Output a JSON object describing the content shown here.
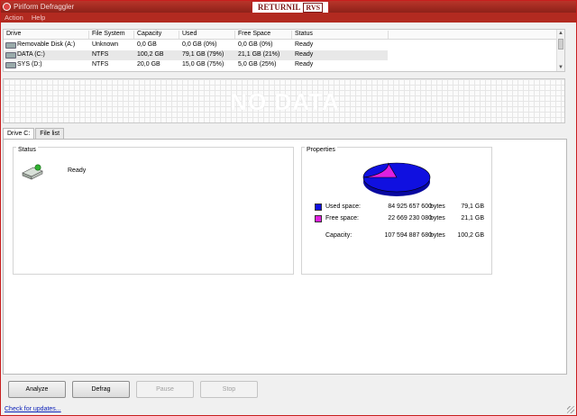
{
  "window": {
    "title": "Piriform Defraggler"
  },
  "returnil": {
    "text": "RETURNIL",
    "badge": "RVS"
  },
  "menu": [
    {
      "label": "Action"
    },
    {
      "label": "Help"
    }
  ],
  "drive_list": {
    "columns": [
      "Drive",
      "File System",
      "Capacity",
      "Used",
      "Free Space",
      "Status"
    ],
    "rows": [
      {
        "drive": "Removable Disk (A:)",
        "fs": "Unknown",
        "capacity": "0,0 GB",
        "used": "0,0 GB (0%)",
        "free": "0,0 GB (0%)",
        "status": "Ready"
      },
      {
        "drive": "DATA (C:)",
        "fs": "NTFS",
        "capacity": "100,2 GB",
        "used": "79,1 GB (79%)",
        "free": "21,1 GB (21%)",
        "status": "Ready",
        "selected": true
      },
      {
        "drive": "SYS (D:)",
        "fs": "NTFS",
        "capacity": "20,0 GB",
        "used": "15,0 GB (75%)",
        "free": "5,0 GB (25%)",
        "status": "Ready"
      }
    ]
  },
  "drive_map": {
    "empty_text": "NO DATA"
  },
  "tabs": [
    {
      "label": "Drive C:",
      "active": true
    },
    {
      "label": "File list",
      "active": false
    }
  ],
  "status": {
    "title": "Status",
    "text": "Ready"
  },
  "properties": {
    "title": "Properties",
    "used_label": "Used space:",
    "used_bytes": "84 925 657 600",
    "used_unit": "bytes",
    "used_gb": "79,1 GB",
    "free_label": "Free space:",
    "free_bytes": "22 669 230 080",
    "free_unit": "bytes",
    "free_gb": "21,1 GB",
    "capacity_label": "Capacity:",
    "capacity_bytes": "107 594 887 680",
    "capacity_unit": "bytes",
    "capacity_gb": "100,2 GB",
    "used_fraction": 0.79,
    "used_color": "#1010e0",
    "free_color": "#e020e0"
  },
  "buttons": {
    "analyze": "Analyze",
    "defrag": "Defrag",
    "pause": "Pause",
    "stop": "Stop"
  },
  "footer": {
    "link": "Check for updates..."
  }
}
